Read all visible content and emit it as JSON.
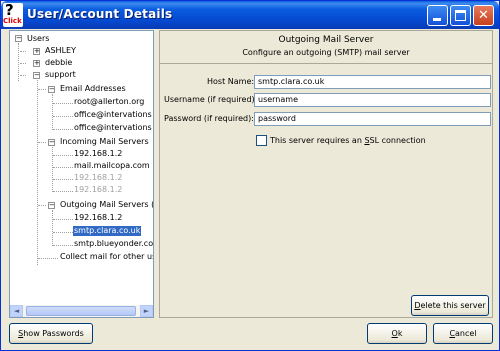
{
  "window": {
    "title": "User/Account Details",
    "app_icon_glyph": "?",
    "app_icon_text": "Click"
  },
  "tree": {
    "root": "Users",
    "users": [
      "ASHLEY",
      "debbie",
      "support"
    ],
    "email_group": "Email Addresses",
    "emails": [
      "root@allerton.org",
      "office@intervations",
      "office@intervations"
    ],
    "incoming_group": "Incoming Mail Servers",
    "incoming": [
      "192.168.1.2",
      "mail.mailcopa.com",
      "192.168.1.2",
      "192.168.1.2"
    ],
    "outgoing_group": "Outgoing Mail Servers (S",
    "outgoing": [
      "192.168.1.2",
      "smtp.clara.co.uk",
      "smtp.blueyonder.co"
    ],
    "collect": "Collect mail for other us",
    "expander_plus": "+",
    "expander_minus": "−",
    "selected": "smtp.clara.co.uk"
  },
  "panel": {
    "title": "Outgoing Mail Server",
    "subtitle": "Configure an outgoing (SMTP) mail server",
    "host_label": "Host Name:",
    "host_value": "smtp.clara.co.uk",
    "username_label": "Username (if required):",
    "username_value": "username",
    "password_label": "Password (if required):",
    "password_value": "password",
    "ssl_label_pre": "This server requires an ",
    "ssl_label_u": "S",
    "ssl_label_post": "SL connection",
    "ssl_checked": false
  },
  "buttons": {
    "delete_u": "D",
    "delete_rest": "elete this server",
    "show_u": "S",
    "show_rest": "how Passwords",
    "ok_u": "O",
    "ok_rest": "k",
    "cancel_u": "C",
    "cancel_rest": "ancel"
  },
  "scroll": {
    "left_arrow": "◄",
    "right_arrow": "►"
  },
  "titlebar_buttons": {
    "close_glyph": "✕"
  },
  "colors": {
    "titlebar": "#0549d0",
    "selection": "#316ac5",
    "window_bg": "#ece9d8"
  }
}
